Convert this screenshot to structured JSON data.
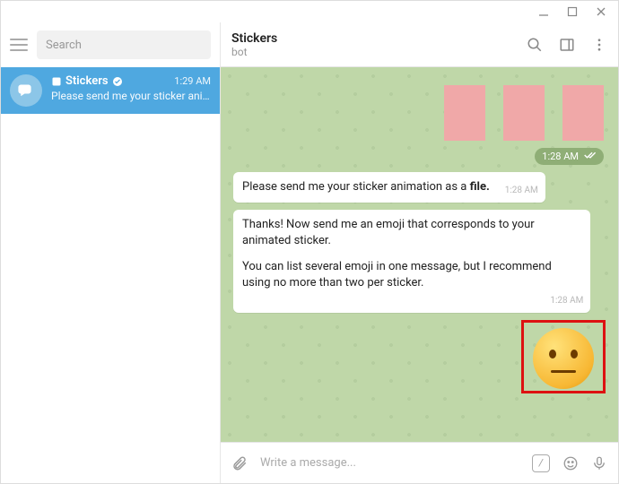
{
  "sidebar": {
    "search_placeholder": "Search",
    "chat": {
      "name": "Stickers",
      "time": "1:29 AM",
      "preview": "Please send me your sticker anim..."
    }
  },
  "header": {
    "title": "Stickers",
    "subtitle": "bot"
  },
  "messages": {
    "sent_time": "1:28 AM",
    "m1_text_a": "Please send me your sticker animation as a ",
    "m1_text_b": "file.",
    "m1_time": "1:28 AM",
    "m2_p1": "Thanks! Now send me an emoji that corresponds to your animated sticker.",
    "m2_p2": "You can list several emoji in one message, but I recommend using no more than two per sticker.",
    "m2_time": "1:28 AM"
  },
  "composer": {
    "placeholder": "Write a message..."
  }
}
